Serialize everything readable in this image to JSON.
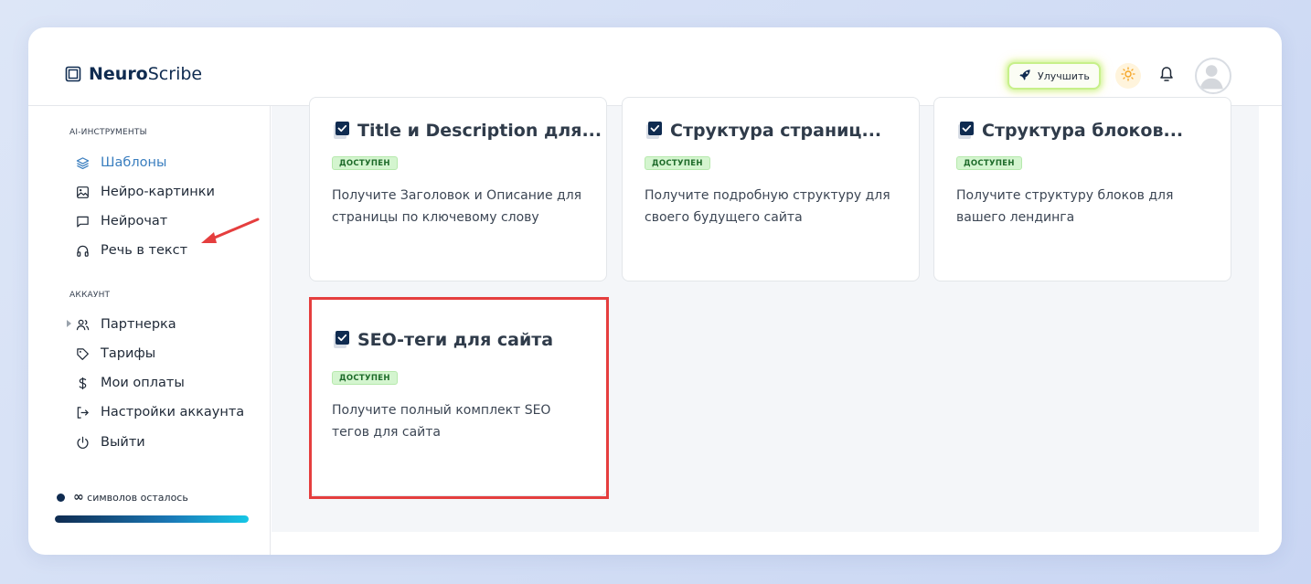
{
  "app": {
    "logo_strong": "Neuro",
    "logo_light": "Scribe"
  },
  "header": {
    "upgrade_label": "Улучшить"
  },
  "sidebar": {
    "section_tools": "AI-ИНСТРУМЕНТЫ",
    "tools": [
      {
        "label": "Шаблоны",
        "icon": "layers-icon",
        "active": true
      },
      {
        "label": "Нейро-картинки",
        "icon": "image-icon"
      },
      {
        "label": "Нейрочат",
        "icon": "chat-icon"
      },
      {
        "label": "Речь в текст",
        "icon": "headphones-icon"
      }
    ],
    "section_account": "АККАУНТ",
    "account": [
      {
        "label": "Партнерка",
        "icon": "users-icon"
      },
      {
        "label": "Тарифы",
        "icon": "tag-icon"
      },
      {
        "label": "Мои оплаты",
        "icon": "dollar-icon"
      },
      {
        "label": "Настройки аккаунта",
        "icon": "logout-arrow-icon"
      },
      {
        "label": "Выйти",
        "icon": "power-icon"
      }
    ],
    "symbols_value": "∞",
    "symbols_label": "символов осталось",
    "symbols_fill_percent": 100
  },
  "cards": [
    {
      "title": "Title и Description для...",
      "badge": "ДОСТУПЕН",
      "desc": "Получите Заголовок и Описание для страницы по ключевому слову"
    },
    {
      "title": "Структура страниц...",
      "badge": "ДОСТУПЕН",
      "desc": "Получите подробную структуру для своего будущего сайта"
    },
    {
      "title": "Структура блоков...",
      "badge": "ДОСТУПЕН",
      "desc": "Получите структуру блоков для вашего лендинга"
    },
    {
      "title": "SEO-теги для сайта",
      "badge": "ДОСТУПЕН",
      "desc": "Получите полный комплект SEO тегов для сайта"
    }
  ],
  "colors": {
    "accent": "#3a7ebf",
    "brand_dark": "#0f2b50",
    "badge_bg": "#d4f5cf",
    "annotation_red": "#e53e3e"
  }
}
